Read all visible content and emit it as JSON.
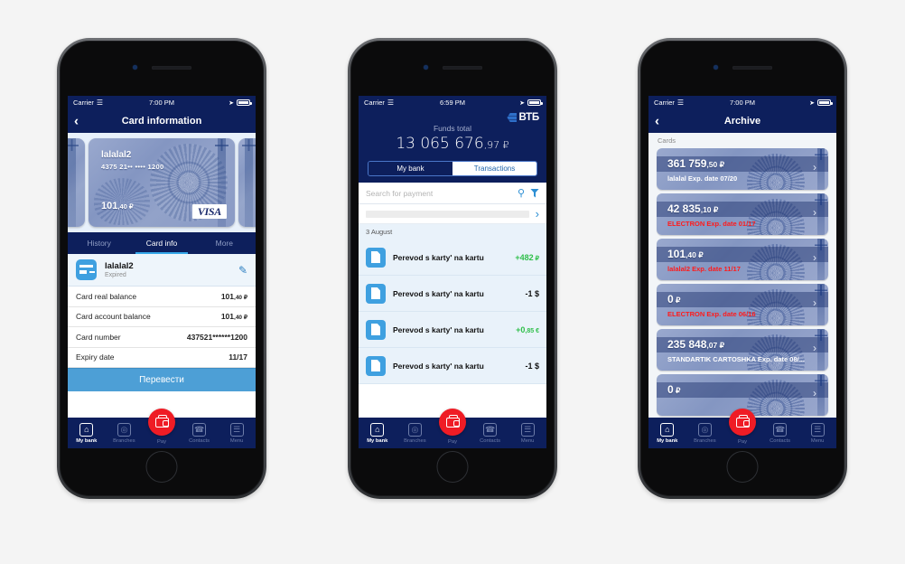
{
  "phone1": {
    "status": {
      "carrier": "Carrier",
      "time": "7:00 PM",
      "wifi_icon": "wifi-icon",
      "location_icon": "location-arrow-icon",
      "battery_icon": "battery-icon"
    },
    "nav": {
      "back_icon": "chevron-left-icon",
      "title": "Card information"
    },
    "card": {
      "name": "lalalal2",
      "number": "4375 21•• •••• 1200",
      "balance_int": "101",
      "balance_frac": ",40 ₽",
      "brand": "VISA"
    },
    "tabs": [
      {
        "label": "History",
        "active": false
      },
      {
        "label": "Card info",
        "active": true
      },
      {
        "label": "More",
        "active": false
      }
    ],
    "account": {
      "name": "lalalal2",
      "status": "Expired",
      "icon": "card-icon",
      "edit_icon": "pencil-icon"
    },
    "rows": [
      {
        "label": "Card real balance",
        "value_int": "101",
        "value_frac": ",40 ₽"
      },
      {
        "label": "Card account balance",
        "value_int": "101",
        "value_frac": ",40 ₽"
      },
      {
        "label": "Card number",
        "value_int": "437521******1200",
        "value_frac": ""
      },
      {
        "label": "Expiry date",
        "value_int": "11/17",
        "value_frac": ""
      }
    ],
    "cta": "Перевести",
    "tabbar": [
      {
        "label": "My bank",
        "icon": "home-icon",
        "glyph": "⌂",
        "active": true
      },
      {
        "label": "Branches",
        "icon": "map-pin-icon",
        "glyph": "⌖",
        "active": false
      },
      {
        "label": "Pay",
        "icon": "wallet-icon",
        "glyph": "",
        "active": false
      },
      {
        "label": "Contacts",
        "icon": "phone-icon",
        "glyph": "✆",
        "active": false
      },
      {
        "label": "Menu",
        "icon": "menu-icon",
        "glyph": "☰",
        "active": false
      }
    ]
  },
  "phone2": {
    "status": {
      "carrier": "Carrier",
      "time": "6:59 PM",
      "wifi_icon": "wifi-icon",
      "location_icon": "location-arrow-icon",
      "battery_icon": "battery-icon"
    },
    "brand": {
      "logo_icon": "vtb-logo-icon",
      "name": "ВТБ"
    },
    "funds": {
      "label": "Funds total",
      "amount_int": "13 065 676",
      "amount_frac": ",97 ₽"
    },
    "segments": [
      {
        "label": "My bank",
        "active": true
      },
      {
        "label": "Transactions",
        "active": false
      }
    ],
    "search": {
      "placeholder": "Search for payment",
      "search_icon": "search-icon",
      "filter_icon": "filter-icon",
      "next_icon": "chevron-right-icon"
    },
    "date_header": "3 August",
    "transactions": [
      {
        "icon": "document-icon",
        "name": "Perevod s karty' na kartu",
        "amount_int": "+482",
        "amount_frac": " ₽",
        "color": "#2fbf4a"
      },
      {
        "icon": "document-icon",
        "name": "Perevod s karty' na kartu",
        "amount_int": "-1",
        "amount_frac": " $",
        "color": "#111111"
      },
      {
        "icon": "document-icon",
        "name": "Perevod s karty' na kartu",
        "amount_int": "+0",
        "amount_frac": ",85 €",
        "color": "#2fbf4a"
      },
      {
        "icon": "document-icon",
        "name": "Perevod s karty' na kartu",
        "amount_int": "-1",
        "amount_frac": " $",
        "color": "#111111"
      }
    ],
    "tabbar": [
      {
        "label": "My bank",
        "icon": "home-icon",
        "glyph": "⌂",
        "active": true
      },
      {
        "label": "Branches",
        "icon": "map-pin-icon",
        "glyph": "⌖",
        "active": false
      },
      {
        "label": "Pay",
        "icon": "wallet-icon",
        "glyph": "",
        "active": false
      },
      {
        "label": "Contacts",
        "icon": "phone-icon",
        "glyph": "✆",
        "active": false
      },
      {
        "label": "Menu",
        "icon": "menu-icon",
        "glyph": "☰",
        "active": false
      }
    ]
  },
  "phone3": {
    "status": {
      "carrier": "Carrier",
      "time": "7:00 PM",
      "wifi_icon": "wifi-icon",
      "location_icon": "location-arrow-icon",
      "battery_icon": "battery-icon"
    },
    "nav": {
      "back_icon": "chevron-left-icon",
      "title": "Archive"
    },
    "section_label": "Cards",
    "cards": [
      {
        "amount_int": "361 759",
        "amount_frac": ",50 ₽",
        "sub": "lalalal Exp. date 07/20",
        "sub_color": "#ffffff"
      },
      {
        "amount_int": "42 835",
        "amount_frac": ",10 ₽",
        "sub": "ELECTRON Exp. date 01/17",
        "sub_color": "#ff1a1a"
      },
      {
        "amount_int": "101",
        "amount_frac": ",40 ₽",
        "sub": "lalalal2 Exp. date 11/17",
        "sub_color": "#ff1a1a"
      },
      {
        "amount_int": "0",
        "amount_frac": " ₽",
        "sub": "ELECTRON Exp. date 06/16",
        "sub_color": "#ff1a1a"
      },
      {
        "amount_int": "235 848",
        "amount_frac": ",07 ₽",
        "sub": "STANDARTIK CARTOSHKA Exp. date 08/...",
        "sub_color": "#ffffff"
      },
      {
        "amount_int": "0",
        "amount_frac": " ₽",
        "sub": "",
        "sub_color": "#ffffff"
      }
    ],
    "tabbar": [
      {
        "label": "My bank",
        "icon": "home-icon",
        "glyph": "⌂",
        "active": true
      },
      {
        "label": "Branches",
        "icon": "map-pin-icon",
        "glyph": "⌖",
        "active": false
      },
      {
        "label": "Pay",
        "icon": "wallet-icon",
        "glyph": "",
        "active": false
      },
      {
        "label": "Contacts",
        "icon": "phone-icon",
        "glyph": "✆",
        "active": false
      },
      {
        "label": "Menu",
        "icon": "menu-icon",
        "glyph": "☰",
        "active": false
      }
    ]
  }
}
